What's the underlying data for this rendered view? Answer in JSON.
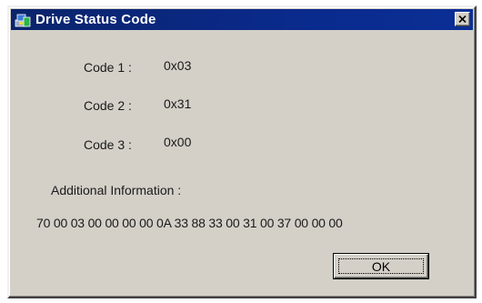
{
  "window": {
    "title": "Drive Status Code",
    "title_icon": "app-icon",
    "close_icon": "close-icon"
  },
  "codes": [
    {
      "label": "Code 1 :",
      "value": "0x03"
    },
    {
      "label": "Code 2 :",
      "value": "0x31"
    },
    {
      "label": "Code 3 :",
      "value": "0x00"
    }
  ],
  "additional": {
    "label": "Additional Information :",
    "value": "70 00 03 00 00 00 00 0A 33 88 33 00 31 00 37 00 00 00"
  },
  "buttons": {
    "ok_label": "OK"
  },
  "colors": {
    "titlebar": "#0a246a",
    "face": "#d4d0c8",
    "title_text": "#ffffff"
  }
}
